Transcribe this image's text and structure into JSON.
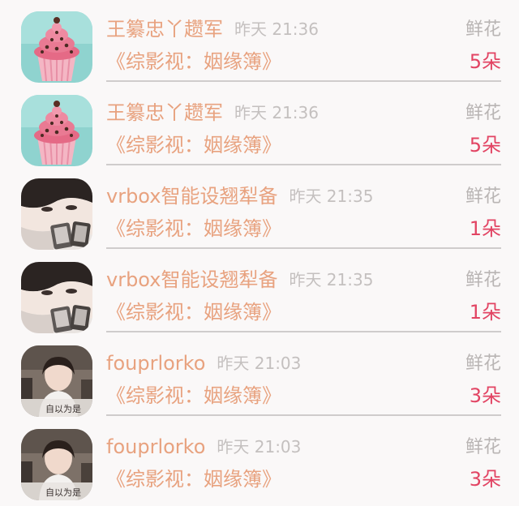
{
  "messages": [
    {
      "name": "王纂忠丫趱军",
      "time": "昨天 21:36",
      "gift": "鲜花",
      "book": "《综影视：姻缘簿》",
      "count": "5朵",
      "avatar_icon": "cupcake-avatar-icon"
    },
    {
      "name": "王纂忠丫趱军",
      "time": "昨天 21:36",
      "gift": "鲜花",
      "book": "《综影视：姻缘簿》",
      "count": "5朵",
      "avatar_icon": "cupcake-avatar-icon"
    },
    {
      "name": "vrbox智能设翘犁备",
      "time": "昨天 21:35",
      "gift": "鲜花",
      "book": "《综影视：姻缘簿》",
      "count": "1朵",
      "avatar_icon": "portrait-avatar-icon"
    },
    {
      "name": "vrbox智能设翘犁备",
      "time": "昨天 21:35",
      "gift": "鲜花",
      "book": "《综影视：姻缘簿》",
      "count": "1朵",
      "avatar_icon": "portrait-avatar-icon"
    },
    {
      "name": "fouprlorko",
      "time": "昨天 21:03",
      "gift": "鲜花",
      "book": "《综影视：姻缘簿》",
      "count": "3朵",
      "avatar_icon": "photo-avatar-icon",
      "avatar_caption": "自以为是"
    },
    {
      "name": "fouprlorko",
      "time": "昨天 21:03",
      "gift": "鲜花",
      "book": "《综影视：姻缘簿》",
      "count": "3朵",
      "avatar_icon": "photo-avatar-icon",
      "avatar_caption": "自以为是"
    }
  ],
  "colors": {
    "name": "#e8a27f",
    "time": "#c4c0bf",
    "gift": "#b9b5b4",
    "count": "#e24463",
    "background": "#faf8f8"
  }
}
